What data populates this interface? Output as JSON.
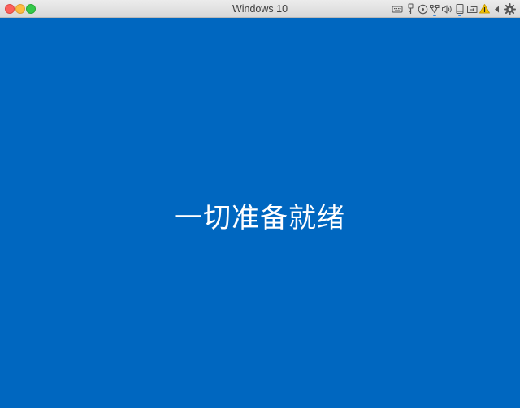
{
  "window": {
    "title": "Windows 10"
  },
  "toolbar": {
    "icons": [
      "keyboard-icon",
      "usb-icon",
      "cd-icon",
      "network-icon",
      "sound-icon",
      "tablet-icon",
      "shared-folder-icon",
      "warning-icon",
      "back-arrow-icon",
      "settings-gear-icon"
    ]
  },
  "screen": {
    "background": "#0067c0",
    "message": "一切准备就绪"
  },
  "colors": {
    "accent": "#0067c0",
    "warning": "#f5c400"
  }
}
